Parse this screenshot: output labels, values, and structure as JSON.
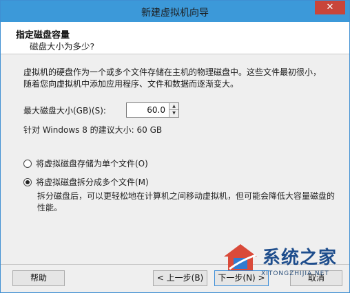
{
  "window": {
    "title": "新建虚拟机向导",
    "close_glyph": "✕"
  },
  "header": {
    "title": "指定磁盘容量",
    "subtitle": "磁盘大小为多少?"
  },
  "content": {
    "description": "虚拟机的硬盘作为一个或多个文件存储在主机的物理磁盘中。这些文件最初很小，随着您向虚拟机中添加应用程序、文件和数据而逐渐变大。",
    "max_size_label": "最大磁盘大小(GB)(S):",
    "max_size_value": "60.0",
    "recommended": "针对 Windows 8 的建议大小: 60 GB",
    "options": [
      {
        "label": "将虚拟磁盘存储为单个文件(O)",
        "selected": false
      },
      {
        "label": "将虚拟磁盘拆分成多个文件(M)",
        "selected": true
      }
    ],
    "split_description": "拆分磁盘后，可以更轻松地在计算机之间移动虚拟机，但可能会降低大容量磁盘的性能。"
  },
  "buttons": {
    "help": "帮助",
    "back": "< 上一步(B)",
    "next": "下一步(N) >",
    "cancel": "取消"
  },
  "watermark": {
    "text": "系统之家",
    "url": "XITONGZHIJIA.NET"
  },
  "colors": {
    "titlebar": "#3c99d9",
    "close": "#c8453a"
  }
}
